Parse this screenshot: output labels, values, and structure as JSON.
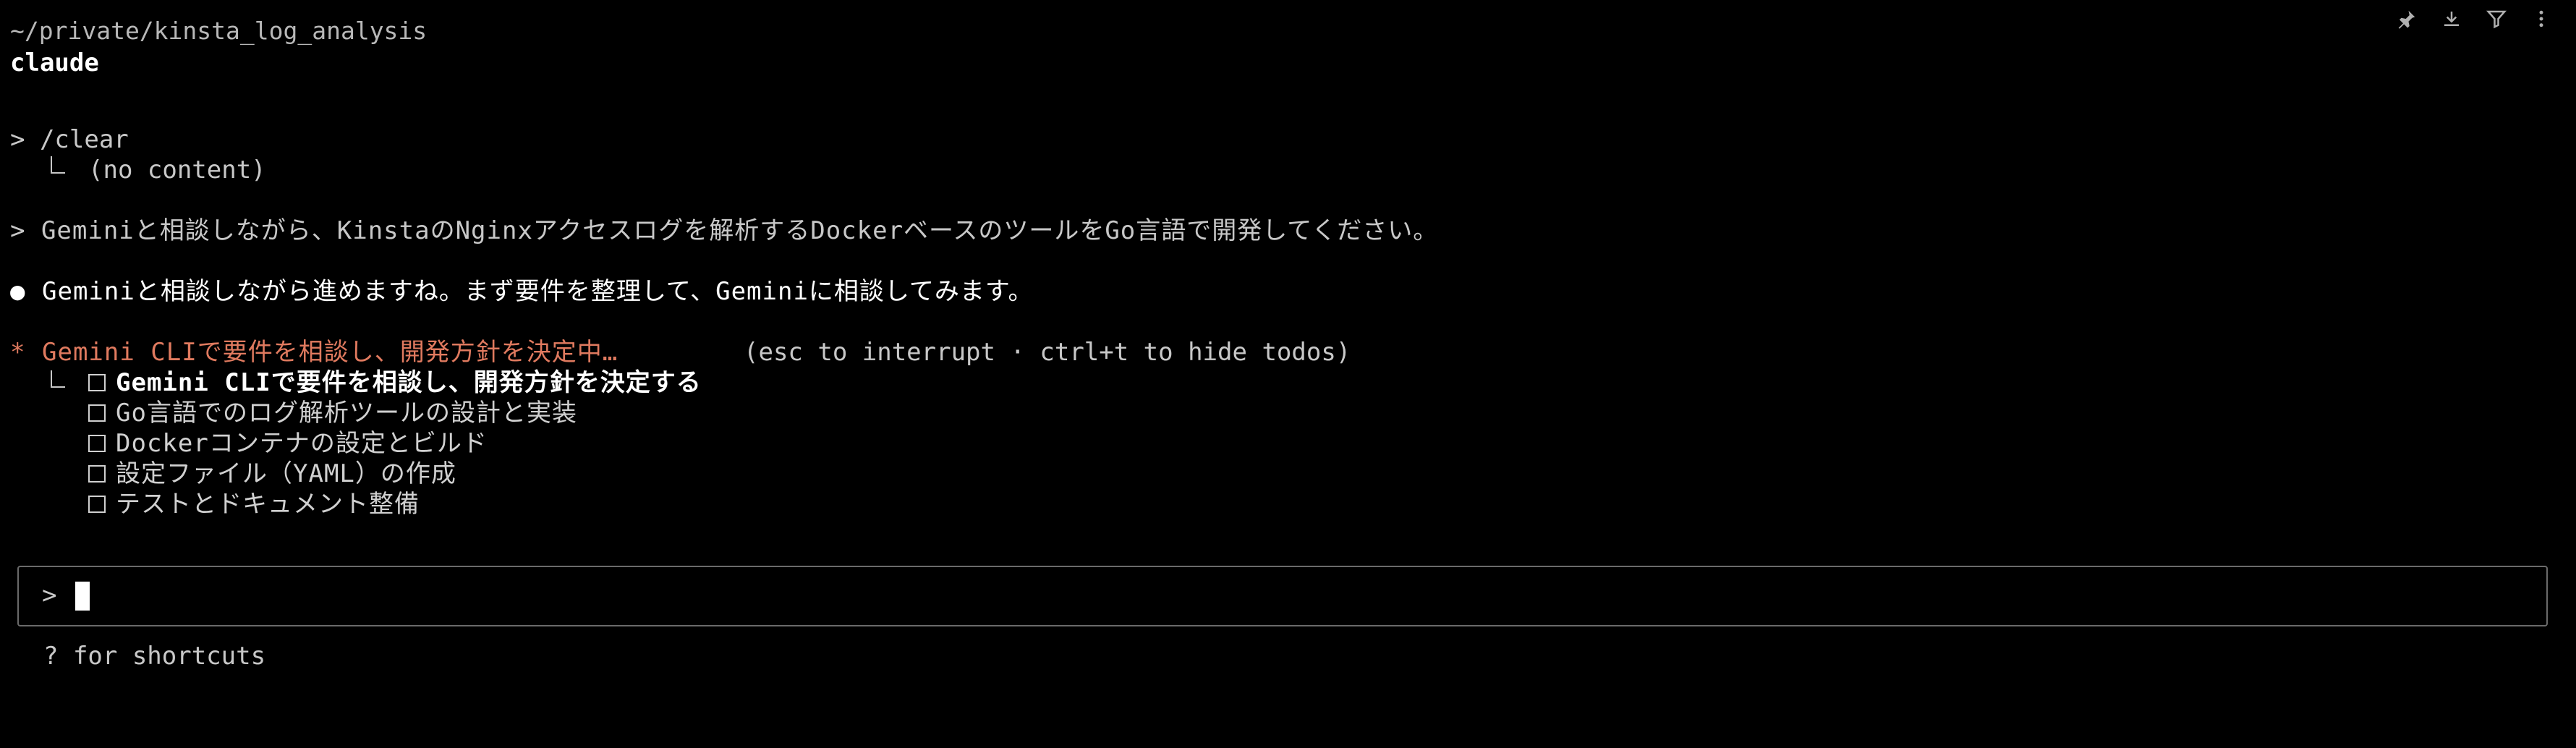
{
  "header": {
    "path": "~/private/kinsta_log_analysis",
    "title": "claude"
  },
  "toolbar": {
    "icons": [
      "pin-icon",
      "download-icon",
      "filter-icon",
      "more-icon"
    ]
  },
  "history": {
    "clear_cmd": "> /clear",
    "clear_result": "(no content)",
    "user_prompt": "> Geminiと相談しながら、KinstaのNginxアクセスログを解析するDockerベースのツールをGo言語で開発してください。",
    "assistant_bullet": "●",
    "assistant_message": "Geminiと相談しながら進めますね。まず要件を整理して、Geminiに相談してみます。"
  },
  "status": {
    "spinner": "*",
    "activity": "Gemini CLIで要件を相談し、開発方針を決定中…",
    "hint": "(esc to interrupt · ctrl+t to hide todos)"
  },
  "todos": [
    {
      "label": "Gemini CLIで要件を相談し、開発方針を決定する",
      "active": true,
      "done": false
    },
    {
      "label": "Go言語でのログ解析ツールの設計と実装",
      "active": false,
      "done": false
    },
    {
      "label": "Dockerコンテナの設定とビルド",
      "active": false,
      "done": false
    },
    {
      "label": "設定ファイル（YAML）の作成",
      "active": false,
      "done": false
    },
    {
      "label": "テストとドキュメント整備",
      "active": false,
      "done": false
    }
  ],
  "input": {
    "prompt": ">",
    "value": ""
  },
  "footer": {
    "shortcuts": "? for shortcuts"
  },
  "colors": {
    "background": "#000000",
    "text": "#d0d0d0",
    "accent": "#e07a5f",
    "border": "#6a6a6a"
  }
}
